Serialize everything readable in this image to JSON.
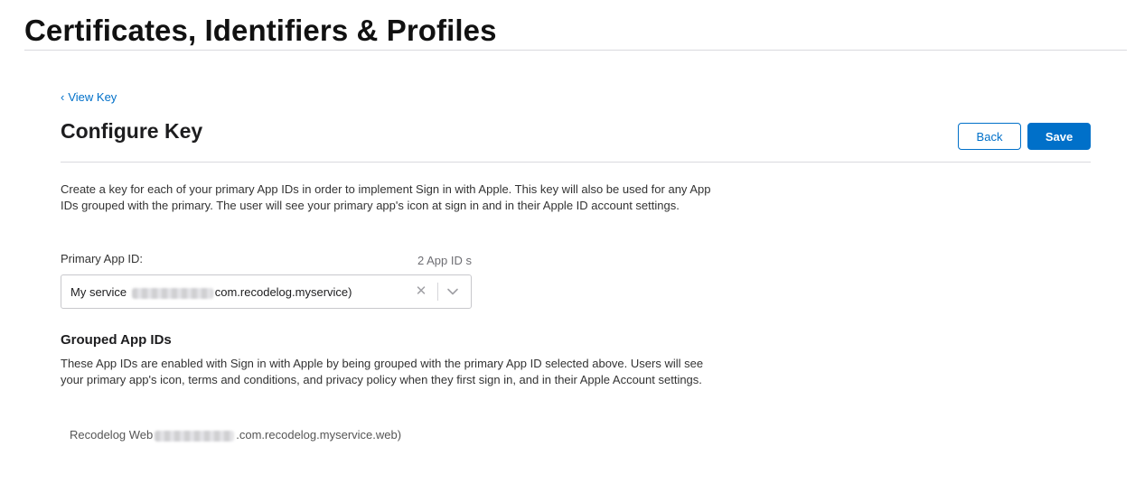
{
  "header": {
    "title": "Certificates, Identifiers & Profiles"
  },
  "nav": {
    "back_link": "View Key"
  },
  "section": {
    "title": "Configure Key"
  },
  "buttons": {
    "back_label": "Back",
    "save_label": "Save"
  },
  "intro_text": "Create a key for each of your primary App IDs in order to implement Sign in with Apple. This key will also be used for any App IDs grouped with the primary. The user will see your primary app's icon at sign in and in their Apple ID account settings.",
  "primary_app_id": {
    "label": "Primary App ID:",
    "count": "2 App ID s",
    "value_prefix": "My service",
    "value_suffix": "com.recodelog.myservice)"
  },
  "grouped": {
    "title": "Grouped App IDs",
    "description": "These App IDs are enabled with Sign in with Apple by being grouped with the primary App ID selected above. Users will see your primary app's icon, terms and conditions, and privacy policy when they first sign in, and in their Apple Account settings.",
    "items": [
      {
        "prefix": "Recodelog Web",
        "suffix": ".com.recodelog.myservice.web)"
      }
    ]
  },
  "colors": {
    "accent": "#0070c9"
  }
}
